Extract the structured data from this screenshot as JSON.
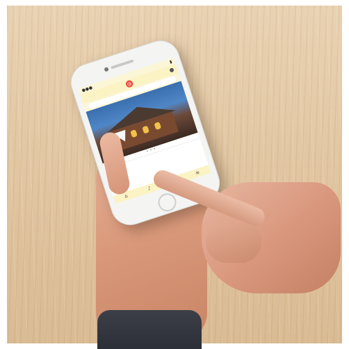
{
  "scene": {
    "description_objects": [
      "wooden-table",
      "smartphone",
      "left-hand",
      "right-hand",
      "sleeve"
    ]
  },
  "phone_screen": {
    "status_left": "●●●",
    "status_right": "▮",
    "logo_glyph": "@",
    "item_text": "",
    "tab_icons": [
      "⌂",
      "♪",
      "☆",
      "≡"
    ]
  },
  "colors": {
    "table": "#e3c8a4",
    "phone_body": "#f4f4f2",
    "app_yellow": "#fbf3c4",
    "logo_red": "#e63a2f"
  }
}
